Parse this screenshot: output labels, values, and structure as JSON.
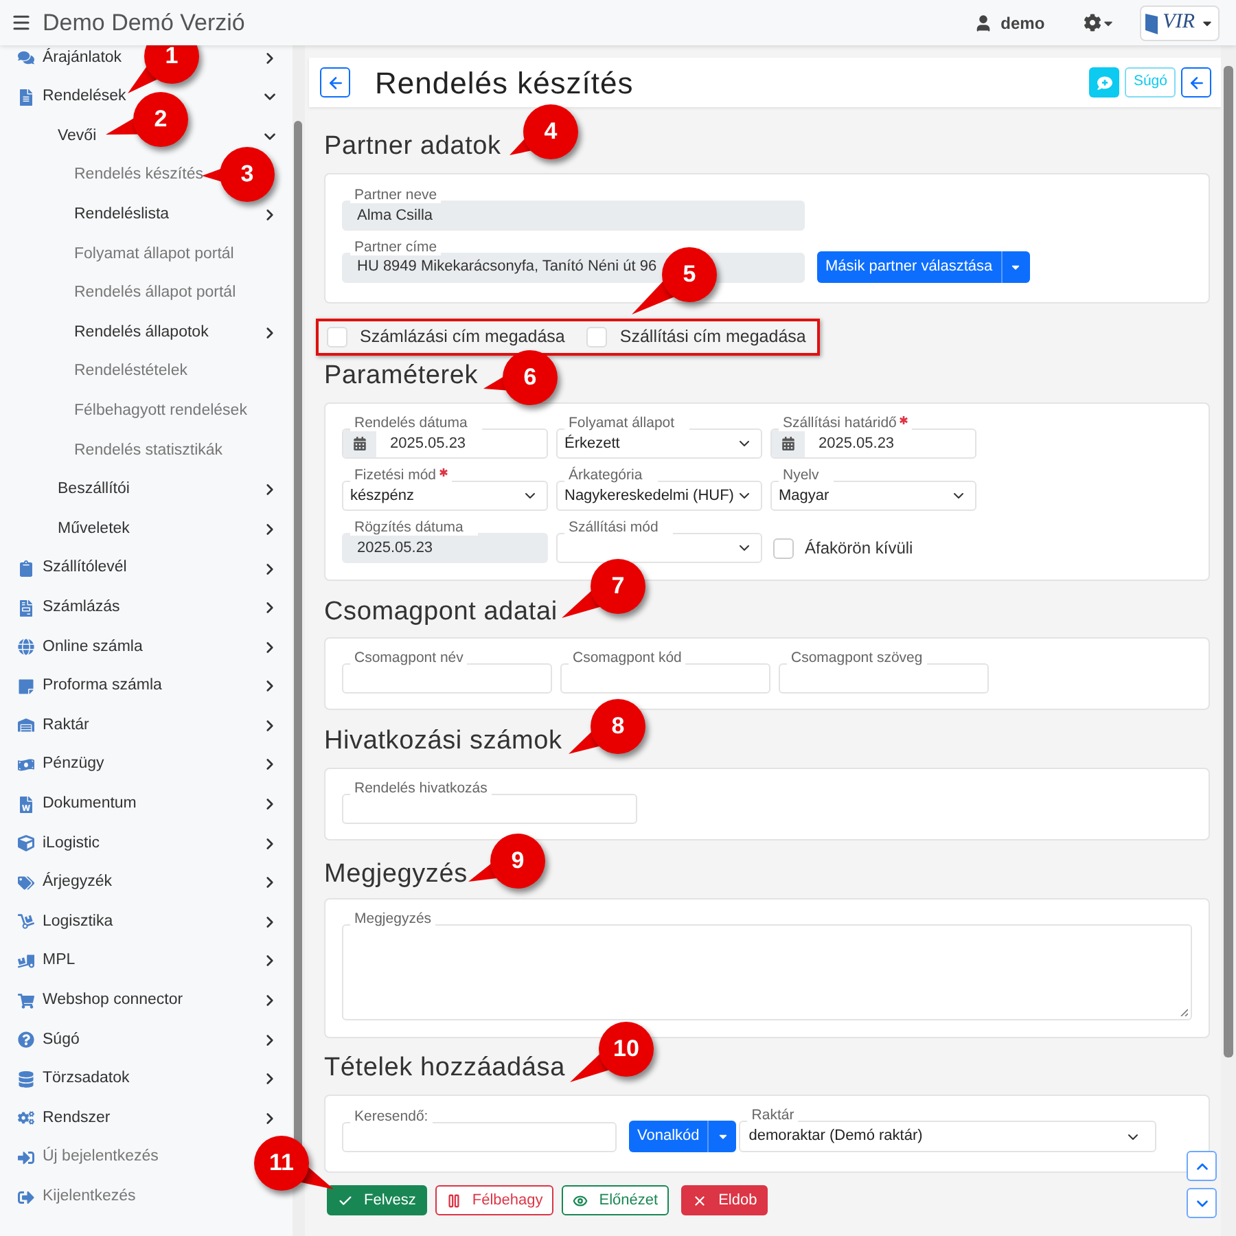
{
  "topbar": {
    "title": "Demo Demó Verzió",
    "user": "demo",
    "logo_text": "VIR"
  },
  "sidebar": {
    "items": [
      {
        "label": "Árajánlatok",
        "expandable": true,
        "expanded": false
      },
      {
        "label": "Rendelések",
        "expandable": true,
        "expanded": true,
        "children": [
          {
            "label": "Vevői",
            "expandable": true,
            "expanded": true,
            "children": [
              {
                "label": "Rendelés készítés",
                "expandable": false
              },
              {
                "label": "Rendeléslista",
                "expandable": true,
                "expanded": false
              },
              {
                "label": "Folyamat állapot portál",
                "expandable": false
              },
              {
                "label": "Rendelés állapot portál",
                "expandable": false
              },
              {
                "label": "Rendelés állapotok",
                "expandable": true,
                "expanded": false
              },
              {
                "label": "Rendeléstételek",
                "expandable": false
              },
              {
                "label": "Félbehagyott rendelések",
                "expandable": false
              },
              {
                "label": "Rendelés statisztikák",
                "expandable": false
              }
            ]
          },
          {
            "label": "Beszállítói",
            "expandable": true,
            "expanded": false
          },
          {
            "label": "Műveletek",
            "expandable": true,
            "expanded": false
          }
        ]
      },
      {
        "label": "Szállítólevél",
        "expandable": true,
        "expanded": false
      },
      {
        "label": "Számlázás",
        "expandable": true,
        "expanded": false
      },
      {
        "label": "Online számla",
        "expandable": true,
        "expanded": false
      },
      {
        "label": "Proforma számla",
        "expandable": true,
        "expanded": false
      },
      {
        "label": "Raktár",
        "expandable": true,
        "expanded": false
      },
      {
        "label": "Pénzügy",
        "expandable": true,
        "expanded": false
      },
      {
        "label": "Dokumentum",
        "expandable": true,
        "expanded": false
      },
      {
        "label": "iLogistic",
        "expandable": true,
        "expanded": false
      },
      {
        "label": "Árjegyzék",
        "expandable": true,
        "expanded": false
      },
      {
        "label": "Logisztika",
        "expandable": true,
        "expanded": false
      },
      {
        "label": "MPL",
        "expandable": true,
        "expanded": false
      },
      {
        "label": "Webshop connector",
        "expandable": true,
        "expanded": false
      },
      {
        "label": "Súgó",
        "expandable": true,
        "expanded": false
      },
      {
        "label": "Törzsadatok",
        "expandable": true,
        "expanded": false
      },
      {
        "label": "Rendszer",
        "expandable": true,
        "expanded": false
      },
      {
        "label": "Új bejelentkezés",
        "expandable": false
      },
      {
        "label": "Kijelentkezés",
        "expandable": false
      }
    ]
  },
  "page": {
    "title": "Rendelés készítés",
    "help_button": "Súgó"
  },
  "partner": {
    "heading": "Partner adatok",
    "fields": [
      {
        "label": "Partner neve",
        "value": "Alma Csilla",
        "disabled": true
      },
      {
        "label": "Partner címe",
        "value": "HU 8949 Mikekarácsonyfa, Tanító Néni út 96",
        "disabled": true
      }
    ],
    "choose_button": "Másik partner választása",
    "address_options": {
      "highlighted": true,
      "items": [
        {
          "label": "Számlázási cím megadása",
          "checked": false
        },
        {
          "label": "Szállítási cím megadása",
          "checked": false
        }
      ]
    }
  },
  "parameters": {
    "heading": "Paraméterek",
    "fields": [
      {
        "kind": "date",
        "label": "Rendelés dátuma",
        "value": "2025.05.23",
        "required": false,
        "disabled": false
      },
      {
        "kind": "select",
        "label": "Folyamat állapot",
        "value": "Érkezett",
        "required": false,
        "disabled": false
      },
      {
        "kind": "date",
        "label": "Szállítási határidő",
        "value": "2025.05.23",
        "required": true,
        "disabled": false
      },
      {
        "kind": "select",
        "label": "Fizetési mód",
        "value": "készpénz",
        "required": true,
        "disabled": false
      },
      {
        "kind": "select",
        "label": "Árkategória",
        "value": "Nagykereskedelmi (HUF)",
        "required": false,
        "disabled": false
      },
      {
        "kind": "select",
        "label": "Nyelv",
        "value": "Magyar",
        "required": false,
        "disabled": false
      },
      {
        "kind": "text",
        "label": "Rögzítés dátuma",
        "value": "2025.05.23",
        "required": false,
        "disabled": true
      },
      {
        "kind": "select",
        "label": "Szállítási mód",
        "required": false,
        "disabled": false
      },
      {
        "kind": "checkbox",
        "label": "Áfakörön kívüli",
        "checked": false
      }
    ]
  },
  "pickup_point": {
    "heading": "Csomagpont adatai",
    "fields": [
      {
        "label": "Csomagpont név"
      },
      {
        "label": "Csomagpont kód"
      },
      {
        "label": "Csomagpont szöveg"
      }
    ]
  },
  "references": {
    "heading": "Hivatkozási számok",
    "fields": [
      {
        "label": "Rendelés hivatkozás"
      }
    ]
  },
  "note": {
    "heading": "Megjegyzés",
    "field": {
      "label": "Megjegyzés"
    }
  },
  "items": {
    "heading": "Tételek hozzáadása",
    "search": {
      "label": "Keresendő:"
    },
    "barcode_button": "Vonalkód",
    "warehouse": {
      "label": "Raktár",
      "value": "demoraktar (Demó raktár)"
    }
  },
  "actions": [
    {
      "kind": "save",
      "label": "Felvesz"
    },
    {
      "kind": "pause",
      "label": "Félbehagy"
    },
    {
      "kind": "preview",
      "label": "Előnézet"
    },
    {
      "kind": "discard",
      "label": "Eldob"
    }
  ],
  "callouts": [
    {
      "number": "1"
    },
    {
      "number": "2"
    },
    {
      "number": "3"
    },
    {
      "number": "4"
    },
    {
      "number": "5"
    },
    {
      "number": "6"
    },
    {
      "number": "7"
    },
    {
      "number": "8"
    },
    {
      "number": "9"
    },
    {
      "number": "10"
    },
    {
      "number": "11"
    }
  ]
}
